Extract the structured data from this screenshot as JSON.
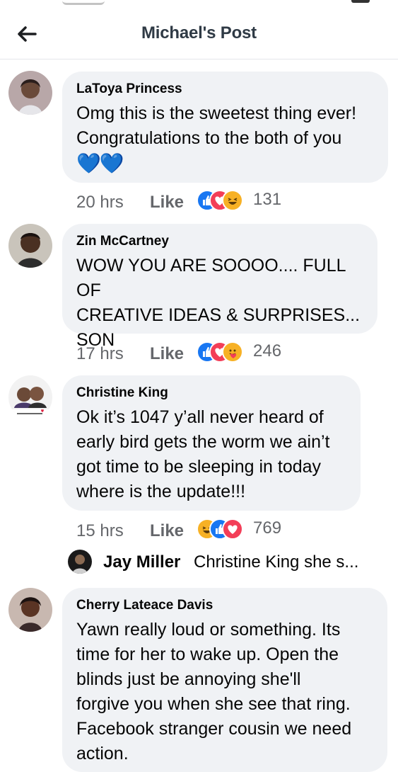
{
  "header": {
    "title": "Michael's Post",
    "back_icon": "arrow-left-icon"
  },
  "comments": [
    {
      "name": "LaToya Princess",
      "text_lines": [
        "Omg this is the sweetest thing ever!",
        "Congratulations to the both of you"
      ],
      "emoji": "💙💙",
      "time": "20 hrs",
      "like_label": "Like",
      "reactions": [
        "like-reaction-icon",
        "love-reaction-icon",
        "haha-reaction-icon"
      ],
      "reaction_count": "131"
    },
    {
      "name": "Zin McCartney",
      "text_lines": [
        "WOW YOU ARE SOOOO.... FULL OF",
        "CREATIVE IDEAS & SURPRISES...",
        "SON"
      ],
      "time": "17 hrs",
      "like_label": "Like",
      "reactions": [
        "like-reaction-icon",
        "love-reaction-icon",
        "care-reaction-icon"
      ],
      "reaction_count": "246"
    },
    {
      "name": "Christine King",
      "text_lines": [
        "Ok it’s 1047 y’all never heard of",
        "early bird gets the worm we ain’t",
        "got time to be sleeping in today",
        "where is the update!!!"
      ],
      "time": "15 hrs",
      "like_label": "Like",
      "reactions": [
        "haha-reaction-icon",
        "like-reaction-icon",
        "love-reaction-icon"
      ],
      "reaction_count": "769",
      "reply": {
        "name": "Jay Miller",
        "text": "Christine King she s..."
      }
    },
    {
      "name": "Cherry Lateace Davis",
      "text_lines": [
        "Yawn really loud or something. Its",
        "time for her to wake up. Open the",
        "blinds just be annoying she'll",
        "forgive you when she see that ring.",
        "Facebook stranger cousin we need",
        "action."
      ]
    }
  ],
  "colors": {
    "like": "#1877f2",
    "love": "#f33e58",
    "haha": "#f7b125",
    "bubble": "#f0f2f5",
    "meta": "#65676b"
  }
}
